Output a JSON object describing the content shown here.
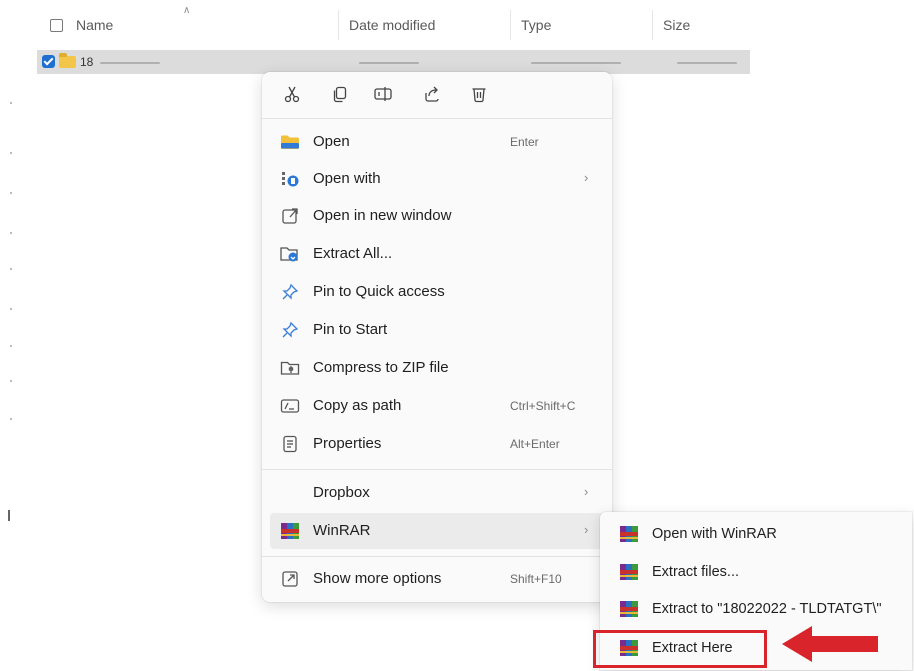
{
  "file_list": {
    "columns": {
      "name": "Name",
      "date_modified": "Date modified",
      "type": "Type",
      "size": "Size"
    },
    "selected_row": {
      "name_prefix": "18"
    }
  },
  "context_menu": {
    "quick_actions": [
      "cut-icon",
      "copy-icon",
      "rename-icon",
      "share-icon",
      "delete-icon"
    ],
    "items": [
      {
        "label": "Open",
        "accelerator": "Enter",
        "icon": "folder-open-icon"
      },
      {
        "label": "Open with",
        "accelerator": "",
        "icon": "open-with-icon",
        "submenu": true
      },
      {
        "label": "Open in new window",
        "accelerator": "",
        "icon": "new-window-icon"
      },
      {
        "label": "Extract All...",
        "accelerator": "",
        "icon": "extract-all-icon"
      },
      {
        "label": "Pin to Quick access",
        "accelerator": "",
        "icon": "pin-icon"
      },
      {
        "label": "Pin to Start",
        "accelerator": "",
        "icon": "pin-icon"
      },
      {
        "label": "Compress to ZIP file",
        "accelerator": "",
        "icon": "zip-icon"
      },
      {
        "label": "Copy as path",
        "accelerator": "Ctrl+Shift+C",
        "icon": "copy-path-icon"
      },
      {
        "label": "Properties",
        "accelerator": "Alt+Enter",
        "icon": "properties-icon"
      },
      {
        "label": "Dropbox",
        "accelerator": "",
        "icon": "",
        "submenu": true
      },
      {
        "label": "WinRAR",
        "accelerator": "",
        "icon": "winrar-icon",
        "submenu": true,
        "highlighted": true
      },
      {
        "label": "Show more options",
        "accelerator": "Shift+F10",
        "icon": "more-options-icon"
      }
    ]
  },
  "winrar_submenu": {
    "items": [
      {
        "label": "Open with WinRAR"
      },
      {
        "label": "Extract files..."
      },
      {
        "label": "Extract to \"18022022 - TLDTATGT\\\""
      },
      {
        "label": "Extract Here",
        "annotated": true
      }
    ]
  },
  "colors": {
    "accent": "#1f6fd1",
    "annotation": "#d8242a",
    "selection": "#dcdcdc",
    "menu_bg": "#fafafa"
  }
}
